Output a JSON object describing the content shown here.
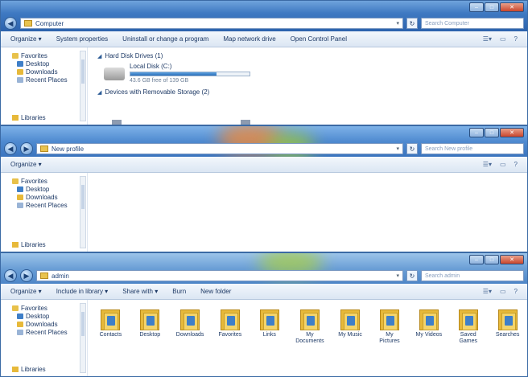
{
  "windows": [
    {
      "address": "Computer",
      "search_placeholder": "Search Computer",
      "toolbar": [
        "Organize ▾",
        "System properties",
        "Uninstall or change a program",
        "Map network drive",
        "Open Control Panel"
      ],
      "nav": {
        "favorites": "Favorites",
        "items": [
          "Desktop",
          "Downloads",
          "Recent Places"
        ],
        "libraries": "Libraries"
      },
      "groups": {
        "hdd": "Hard Disk Drives (1)",
        "removable": "Devices with Removable Storage (2)"
      },
      "drive": {
        "name": "Local Disk (C:)",
        "used_fraction": 0.72,
        "free_text": "43.6 GB free of 139 GB"
      }
    },
    {
      "address": "New profile",
      "search_placeholder": "Search New profile",
      "toolbar": [
        "Organize ▾"
      ],
      "nav": {
        "favorites": "Favorites",
        "items": [
          "Desktop",
          "Downloads",
          "Recent Places"
        ],
        "libraries": "Libraries"
      }
    },
    {
      "address": "admin",
      "search_placeholder": "Search admin",
      "toolbar": [
        "Organize ▾",
        "Include in library ▾",
        "Share with ▾",
        "Burn",
        "New folder"
      ],
      "nav": {
        "favorites": "Favorites",
        "items": [
          "Desktop",
          "Downloads",
          "Recent Places"
        ],
        "libraries": "Libraries"
      },
      "folders": [
        "Contacts",
        "Desktop",
        "Downloads",
        "Favorites",
        "Links",
        "My Documents",
        "My Music",
        "My Pictures",
        "My Videos",
        "Saved Games",
        "Searches"
      ]
    }
  ],
  "colors": {
    "folder": "#e7b93a",
    "accent": "#2c63ad",
    "glow_orange": "#f08a3a",
    "glow_green": "#9cc93c"
  }
}
